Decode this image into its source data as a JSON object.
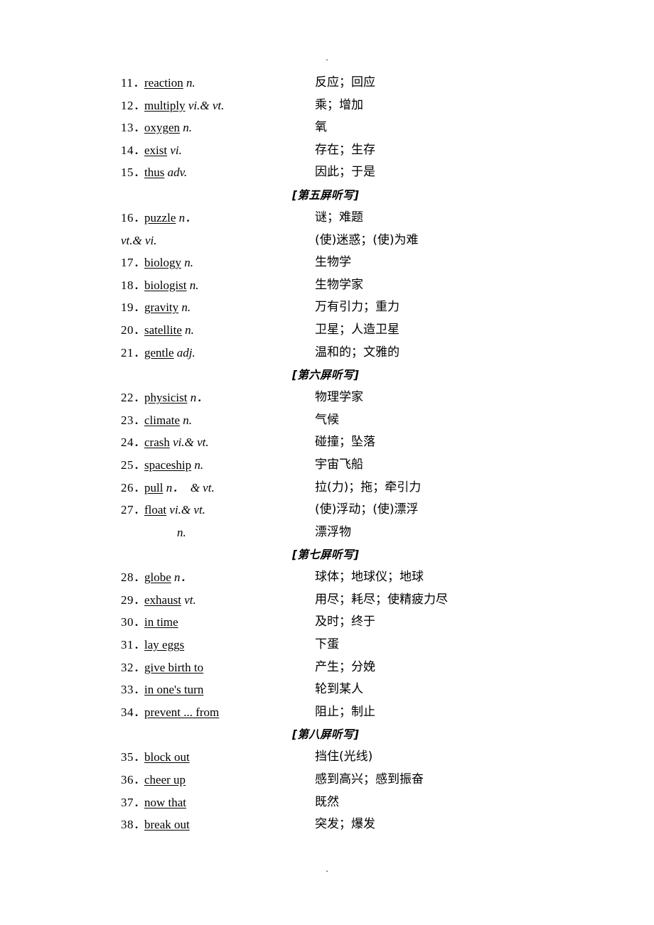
{
  "page": {
    "header_mark": ".",
    "footer_mark": "."
  },
  "blocks": [
    {
      "type": "entries",
      "entries": [
        {
          "num": "11．",
          "headword": "reaction",
          "pos": " n.",
          "cn": "反应；回应"
        },
        {
          "num": "12．",
          "headword": "multiply",
          "pos": " vi.& vt.",
          "cn": "乘；增加"
        },
        {
          "num": "13．",
          "headword": "oxygen",
          "pos": " n.",
          "cn": "氧"
        },
        {
          "num": "14．",
          "headword": "exist",
          "pos": " vi.",
          "cn": "存在；生存"
        },
        {
          "num": "15．",
          "headword": "thus",
          "pos": " adv.",
          "cn": "因此；于是"
        }
      ]
    },
    {
      "type": "header",
      "label": "[第五屏听写]"
    },
    {
      "type": "entries",
      "entries": [
        {
          "num": "16．",
          "headword": "puzzle",
          "pos": " n．",
          "cn": "谜；难题"
        },
        {
          "num": "",
          "headword": "",
          "pos": "vt.& vi.",
          "cn": "(使)迷惑；(使)为难",
          "continuation": "left"
        },
        {
          "num": "17．",
          "headword": "biology",
          "pos": " n.",
          "cn": "生物学"
        },
        {
          "num": "18．",
          "headword": "biologist",
          "pos": " n.",
          "cn": "生物学家"
        },
        {
          "num": "19．",
          "headword": "gravity",
          "pos": " n.",
          "cn": "万有引力；重力"
        },
        {
          "num": "20．",
          "headword": "satellite",
          "pos": " n.",
          "cn": "卫星；人造卫星"
        },
        {
          "num": "21．",
          "headword": "gentle",
          "pos": " adj.",
          "cn": "温和的；文雅的"
        }
      ]
    },
    {
      "type": "header",
      "label": "[第六屏听写]"
    },
    {
      "type": "entries",
      "entries": [
        {
          "num": "22．",
          "headword": "physicist",
          "pos": " n．",
          "cn": "物理学家"
        },
        {
          "num": "23．",
          "headword": "climate",
          "pos": " n.",
          "cn": "气候"
        },
        {
          "num": "24．",
          "headword": "crash",
          "pos": " vi.& vt.",
          "cn": "碰撞；坠落"
        },
        {
          "num": "25．",
          "headword": "spaceship",
          "pos": " n.",
          "cn": "宇宙飞船"
        },
        {
          "num": "26．",
          "headword": "pull",
          "pos": " n．  & vt.",
          "cn": "拉(力)；拖；牵引力"
        },
        {
          "num": "27．",
          "headword": "float",
          "pos": " vi.& vt.",
          "cn": "(使)浮动；(使)漂浮"
        },
        {
          "num": "",
          "headword": "",
          "pos": "n.",
          "cn": "漂浮物",
          "continuation": "indent"
        }
      ]
    },
    {
      "type": "header",
      "label": "[第七屏听写]"
    },
    {
      "type": "entries",
      "entries": [
        {
          "num": "28．",
          "headword": "globe",
          "pos": " n．",
          "cn": "球体；地球仪；地球"
        },
        {
          "num": "29．",
          "headword": "exhaust",
          "pos": " vt.",
          "cn": "用尽；耗尽；使精疲力尽"
        },
        {
          "num": "30．",
          "headword": "in time",
          "pos": "",
          "cn": "及时；终于"
        },
        {
          "num": "31．",
          "headword": "lay eggs",
          "pos": "",
          "cn": "下蛋"
        },
        {
          "num": "32．",
          "headword": "give birth to",
          "pos": "",
          "cn": "产生；分娩"
        },
        {
          "num": "33．",
          "headword": "in one's turn",
          "pos": "",
          "cn": "轮到某人"
        },
        {
          "num": "34．",
          "headword": "prevent ... from",
          "pos": "",
          "cn": "阻止；制止"
        }
      ]
    },
    {
      "type": "header",
      "label": "[第八屏听写]"
    },
    {
      "type": "entries",
      "entries": [
        {
          "num": "35．",
          "headword": "block out",
          "pos": "",
          "cn": "挡住(光线)"
        },
        {
          "num": "36．",
          "headword": "cheer up",
          "pos": "",
          "cn": "感到高兴；感到振奋"
        },
        {
          "num": "37．",
          "headword": "now that",
          "pos": "",
          "cn": "既然"
        },
        {
          "num": "38．",
          "headword": "break out",
          "pos": "",
          "cn": "突发；爆发"
        }
      ]
    }
  ]
}
